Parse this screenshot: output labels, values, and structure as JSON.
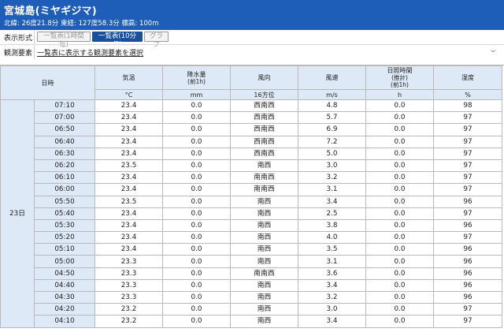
{
  "station": {
    "title": "宮城島(ミヤギジマ)",
    "coords": "北緯: 26度21.8分 東経: 127度58.3分 標高: 100m"
  },
  "controls": {
    "display_label": "表示形式",
    "buttons": [
      {
        "label": "一覧表(1時間毎)",
        "active": false
      },
      {
        "label": "一覧表(10分毎)",
        "active": true
      },
      {
        "label": "グラフ",
        "active": false
      }
    ],
    "elements_label": "観測要素",
    "elements_selector": "一覧表に表示する観測要素を選択"
  },
  "table": {
    "headers": {
      "datetime": "日時",
      "temp": "気温",
      "precip": "降水量",
      "precip_sub": "(前1h)",
      "wind_dir": "風向",
      "wind_speed": "風速",
      "sunshine": "日照時間",
      "sunshine_sub1": "(推計)",
      "sunshine_sub2": "(前1h)",
      "humidity": "湿度"
    },
    "units": {
      "temp": "°C",
      "precip": "mm",
      "wind_dir": "16方位",
      "wind_speed": "m/s",
      "sunshine": "h",
      "humidity": "%"
    },
    "day": "23日",
    "rows": [
      {
        "time": "07:10",
        "temp": "23.4",
        "precip": "0.0",
        "dir": "西南西",
        "speed": "4.8",
        "sun": "0.0",
        "hum": "98"
      },
      {
        "time": "07:00",
        "temp": "23.4",
        "precip": "0.0",
        "dir": "西南西",
        "speed": "5.7",
        "sun": "0.0",
        "hum": "97"
      },
      {
        "time": "06:50",
        "temp": "23.4",
        "precip": "0.0",
        "dir": "西南西",
        "speed": "6.9",
        "sun": "0.0",
        "hum": "97"
      },
      {
        "time": "06:40",
        "temp": "23.4",
        "precip": "0.0",
        "dir": "西南西",
        "speed": "7.2",
        "sun": "0.0",
        "hum": "97"
      },
      {
        "time": "06:30",
        "temp": "23.4",
        "precip": "0.0",
        "dir": "西南西",
        "speed": "5.0",
        "sun": "0.0",
        "hum": "97"
      },
      {
        "time": "06:20",
        "temp": "23.5",
        "precip": "0.0",
        "dir": "南西",
        "speed": "3.0",
        "sun": "0.0",
        "hum": "97"
      },
      {
        "time": "06:10",
        "temp": "23.4",
        "precip": "0.0",
        "dir": "南南西",
        "speed": "3.2",
        "sun": "0.0",
        "hum": "97"
      },
      {
        "time": "06:00",
        "temp": "23.4",
        "precip": "0.0",
        "dir": "南南西",
        "speed": "3.1",
        "sun": "0.0",
        "hum": "97"
      },
      {
        "time": "05:50",
        "temp": "23.5",
        "precip": "0.0",
        "dir": "南西",
        "speed": "3.4",
        "sun": "0.0",
        "hum": "96"
      },
      {
        "time": "05:40",
        "temp": "23.4",
        "precip": "0.0",
        "dir": "南西",
        "speed": "2.5",
        "sun": "0.0",
        "hum": "97"
      },
      {
        "time": "05:30",
        "temp": "23.4",
        "precip": "0.0",
        "dir": "南西",
        "speed": "3.8",
        "sun": "0.0",
        "hum": "96"
      },
      {
        "time": "05:20",
        "temp": "23.4",
        "precip": "0.0",
        "dir": "南西",
        "speed": "4.0",
        "sun": "0.0",
        "hum": "97"
      },
      {
        "time": "05:10",
        "temp": "23.4",
        "precip": "0.0",
        "dir": "南西",
        "speed": "3.5",
        "sun": "0.0",
        "hum": "96"
      },
      {
        "time": "05:00",
        "temp": "23.3",
        "precip": "0.0",
        "dir": "南西",
        "speed": "3.1",
        "sun": "0.0",
        "hum": "96"
      },
      {
        "time": "04:50",
        "temp": "23.3",
        "precip": "0.0",
        "dir": "南南西",
        "speed": "3.6",
        "sun": "0.0",
        "hum": "96"
      },
      {
        "time": "04:40",
        "temp": "23.3",
        "precip": "0.0",
        "dir": "南西",
        "speed": "3.4",
        "sun": "0.0",
        "hum": "96"
      },
      {
        "time": "04:30",
        "temp": "23.3",
        "precip": "0.0",
        "dir": "南西",
        "speed": "3.2",
        "sun": "0.0",
        "hum": "96"
      },
      {
        "time": "04:20",
        "temp": "23.2",
        "precip": "0.0",
        "dir": "南西",
        "speed": "3.0",
        "sun": "0.0",
        "hum": "97"
      },
      {
        "time": "04:10",
        "temp": "23.2",
        "precip": "0.0",
        "dir": "南西",
        "speed": "3.4",
        "sun": "0.0",
        "hum": "97"
      }
    ]
  }
}
